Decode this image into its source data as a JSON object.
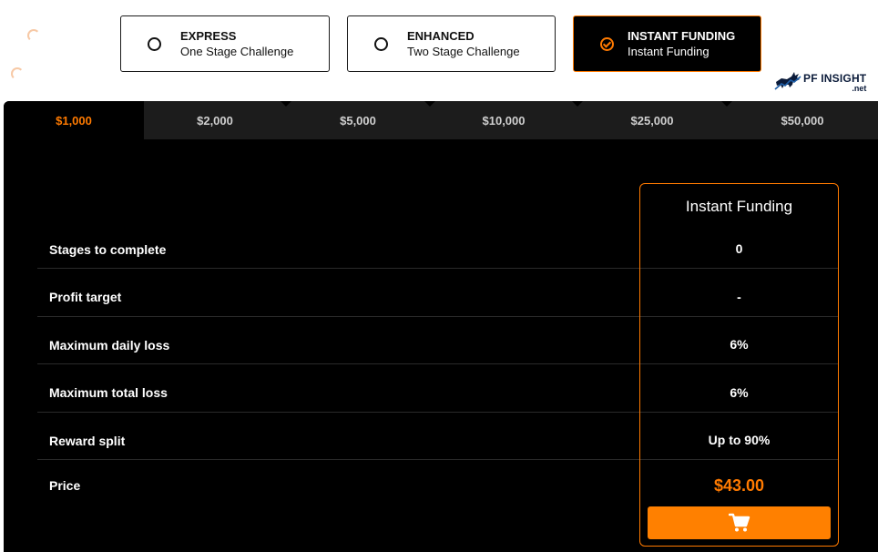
{
  "plans": [
    {
      "title": "EXPRESS",
      "subtitle": "One Stage Challenge",
      "selected": false
    },
    {
      "title": "ENHANCED",
      "subtitle": "Two Stage Challenge",
      "selected": false
    },
    {
      "title": "INSTANT FUNDING",
      "subtitle": "Instant Funding",
      "selected": true
    }
  ],
  "logo": {
    "name": "PF INSIGHT",
    "suffix": ".net"
  },
  "tabs": [
    {
      "label": "$1,000",
      "active": true
    },
    {
      "label": "$2,000",
      "active": false
    },
    {
      "label": "$5,000",
      "active": false
    },
    {
      "label": "$10,000",
      "active": false
    },
    {
      "label": "$25,000",
      "active": false
    },
    {
      "label": "$50,000",
      "active": false
    }
  ],
  "features": {
    "stages": "Stages to complete",
    "profit_target": "Profit target",
    "daily_loss": "Maximum daily loss",
    "total_loss": "Maximum total loss",
    "reward_split": "Reward split",
    "price": "Price"
  },
  "column": {
    "title": "Instant Funding",
    "stages": "0",
    "profit_target": "-",
    "daily_loss": "6%",
    "total_loss": "6%",
    "reward_split": "Up to 90%",
    "price": "$43.00",
    "button_icon": "cart-icon"
  },
  "colors": {
    "accent": "#ff7a00",
    "panel": "#000000",
    "tab_bg": "#1c1c1c"
  }
}
